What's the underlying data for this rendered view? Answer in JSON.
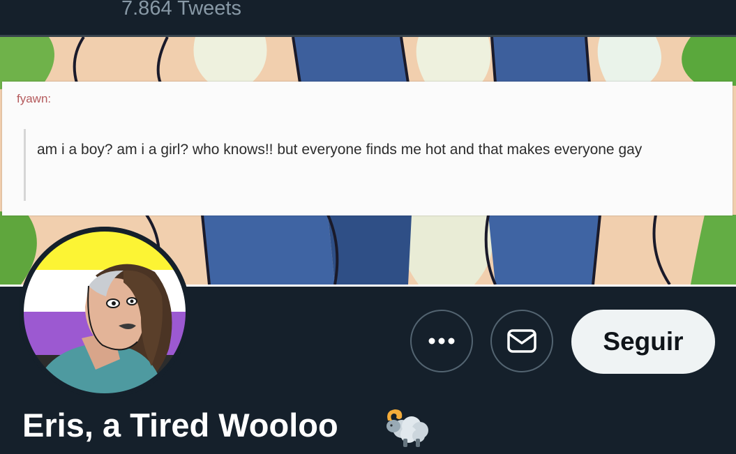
{
  "profile": {
    "tweet_count": "7.864 Tweets",
    "display_name": "Eris, a Tired Wooloo",
    "name_emoji": "sheep-emoji"
  },
  "banner": {
    "quote_author": "fyawn:",
    "quote_text": "am i a boy? am i a girl? who knows!! but everyone finds me hot and that makes everyone gay"
  },
  "actions": {
    "more_icon": "more-horizontal-icon",
    "message_icon": "envelope-icon",
    "follow_label": "Seguir"
  },
  "colors": {
    "background": "#15202b",
    "follow_button_bg": "#eff3f4",
    "flag_yellow": "#fcf434",
    "flag_white": "#ffffff",
    "flag_purple": "#9c59d1",
    "flag_black": "#2c2c2c"
  }
}
